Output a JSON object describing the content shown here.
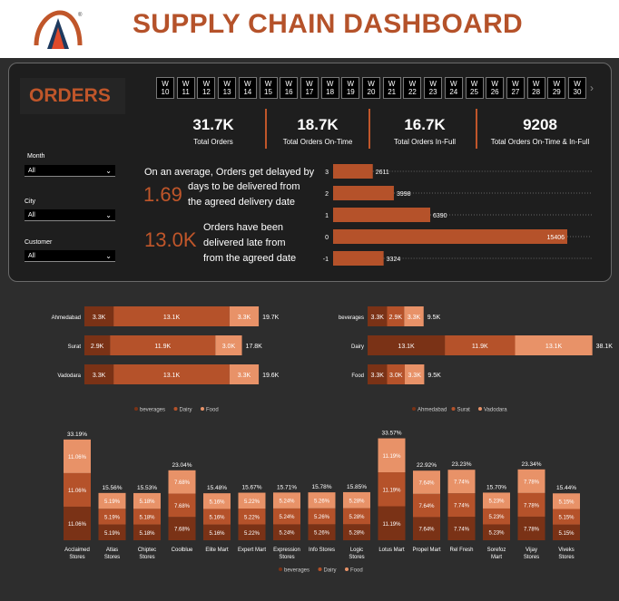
{
  "header": {
    "title": "SUPPLY CHAIN DASHBOARD",
    "logo_icon": "a-letter-logo-icon",
    "logo_mark": "®"
  },
  "orders_panel": {
    "title": "ORDERS",
    "weeks": [
      [
        "W",
        "10"
      ],
      [
        "W",
        "11"
      ],
      [
        "W",
        "12"
      ],
      [
        "W",
        "13"
      ],
      [
        "W",
        "14"
      ],
      [
        "W",
        "15"
      ],
      [
        "W",
        "16"
      ],
      [
        "W",
        "17"
      ],
      [
        "W",
        "18"
      ],
      [
        "W",
        "19"
      ],
      [
        "W",
        "20"
      ],
      [
        "W",
        "21"
      ],
      [
        "W",
        "22"
      ],
      [
        "W",
        "23"
      ],
      [
        "W",
        "24"
      ],
      [
        "W",
        "25"
      ],
      [
        "W",
        "26"
      ],
      [
        "W",
        "27"
      ],
      [
        "W",
        "28"
      ],
      [
        "W",
        "29"
      ],
      [
        "W",
        "30"
      ]
    ],
    "week_scroll": "›",
    "kpis": [
      {
        "value": "31.7K",
        "label": "Total Orders"
      },
      {
        "value": "18.7K",
        "label": "Total Orders On-Time"
      },
      {
        "value": "16.7K",
        "label": "Total Orders In-Full"
      },
      {
        "value": "9208",
        "label": "Total Orders On-Time & In-Full"
      }
    ],
    "filters": [
      {
        "label": "Month",
        "value": "All"
      },
      {
        "label": "City",
        "value": "All"
      },
      {
        "label": "Customer",
        "value": "All"
      }
    ],
    "delay_stat": {
      "value": "1.69",
      "prefix": "On an average, Orders get delayed by",
      "line2": "days to be delivered from",
      "line3": "the agreed delivery date"
    },
    "late_stat": {
      "value": "13.0K",
      "line1": "Orders have been",
      "line2": "delivered late from",
      "line3": "from the agreed date"
    }
  },
  "colors": {
    "beverages": "#7a3216",
    "dairy": "#b5522a",
    "food": "#e89268",
    "accent": "#c0562a"
  },
  "chart_data": [
    {
      "type": "bar",
      "orientation": "horizontal",
      "categories": [
        "3",
        "2",
        "1",
        "0",
        "-1"
      ],
      "values": [
        2611,
        3998,
        6390,
        15406,
        3324
      ],
      "labels": [
        "2611",
        "3998",
        "6390",
        "15406",
        "3324"
      ]
    },
    {
      "type": "bar",
      "orientation": "horizontal",
      "stacked": true,
      "categories": [
        "Ahmedabad",
        "Surat",
        "Vadodara"
      ],
      "series": [
        {
          "name": "beverages",
          "values": [
            3.3,
            2.9,
            3.3
          ],
          "labels": [
            "3.3K",
            "2.9K",
            "3.3K"
          ]
        },
        {
          "name": "Dairy",
          "values": [
            13.1,
            11.9,
            13.1
          ],
          "labels": [
            "13.1K",
            "11.9K",
            "13.1K"
          ]
        },
        {
          "name": "Food",
          "values": [
            3.3,
            3.0,
            3.3
          ],
          "labels": [
            "3.3K",
            "3.0K",
            "3.3K"
          ]
        }
      ],
      "totals": [
        "19.7K",
        "17.8K",
        "19.6K"
      ],
      "legend": [
        "beverages",
        "Dairy",
        "Food"
      ]
    },
    {
      "type": "bar",
      "orientation": "horizontal",
      "stacked": true,
      "categories": [
        "beverages",
        "Dairy",
        "Food"
      ],
      "series": [
        {
          "name": "Ahmedabad",
          "values": [
            3.3,
            13.1,
            3.3
          ],
          "labels": [
            "3.3K",
            "13.1K",
            "3.3K"
          ]
        },
        {
          "name": "Surat",
          "values": [
            2.9,
            11.9,
            3.0
          ],
          "labels": [
            "2.9K",
            "11.9K",
            "3.0K"
          ]
        },
        {
          "name": "Vadodara",
          "values": [
            3.3,
            13.1,
            3.3
          ],
          "labels": [
            "3.3K",
            "13.1K",
            "3.3K"
          ]
        }
      ],
      "totals": [
        "9.5K",
        "38.1K",
        "9.5K"
      ],
      "legend": [
        "Ahmedabad",
        "Surat",
        "Vadodara"
      ]
    },
    {
      "type": "bar",
      "orientation": "vertical",
      "stacked": true,
      "categories": [
        "Acclaimed Stores",
        "Atlas Stores",
        "Chiptec Stores",
        "Coolblue",
        "Elite Mart",
        "Expert Mart",
        "Expression Stores",
        "Info Stores",
        "Logic Stores",
        "Lotus Mart",
        "Propel Mart",
        "Rel Fresh",
        "Sorefoz Mart",
        "Vijay Stores",
        "Viveks Stores"
      ],
      "series": [
        {
          "name": "beverages",
          "values": [
            11.06,
            5.19,
            5.18,
            7.68,
            5.16,
            5.22,
            5.24,
            5.26,
            5.28,
            11.19,
            7.64,
            7.74,
            5.23,
            7.78,
            5.15
          ],
          "labels": [
            "11.06%",
            "5.19%",
            "5.18%",
            "7.68%",
            "5.16%",
            "5.22%",
            "5.24%",
            "5.26%",
            "5.28%",
            "11.19%",
            "7.64%",
            "7.74%",
            "5.23%",
            "7.78%",
            "5.15%"
          ]
        },
        {
          "name": "Dairy",
          "values": [
            11.06,
            5.19,
            5.18,
            7.68,
            5.16,
            5.22,
            5.24,
            5.26,
            5.28,
            11.19,
            7.64,
            7.74,
            5.23,
            7.78,
            5.15
          ],
          "labels": [
            "11.06%",
            "5.19%",
            "5.18%",
            "7.68%",
            "5.16%",
            "5.22%",
            "5.24%",
            "5.26%",
            "5.28%",
            "11.19%",
            "7.64%",
            "7.74%",
            "5.23%",
            "7.78%",
            "5.15%"
          ]
        },
        {
          "name": "Food",
          "values": [
            11.06,
            5.19,
            5.18,
            7.68,
            5.16,
            5.22,
            5.24,
            5.26,
            5.28,
            11.19,
            7.64,
            7.74,
            5.23,
            7.78,
            5.15
          ],
          "labels": [
            "11.06%",
            "5.19%",
            "5.18%",
            "7.68%",
            "5.16%",
            "5.22%",
            "5.24%",
            "5.26%",
            "5.28%",
            "11.19%",
            "7.64%",
            "7.74%",
            "5.23%",
            "7.78%",
            "5.15%"
          ]
        }
      ],
      "totals": [
        "33.19%",
        "15.56%",
        "15.53%",
        "23.04%",
        "15.48%",
        "15.67%",
        "15.71%",
        "15.78%",
        "15.85%",
        "33.57%",
        "22.92%",
        "23.23%",
        "15.70%",
        "23.34%",
        "15.44%"
      ],
      "legend": [
        "beverages",
        "Dairy",
        "Food"
      ]
    }
  ]
}
